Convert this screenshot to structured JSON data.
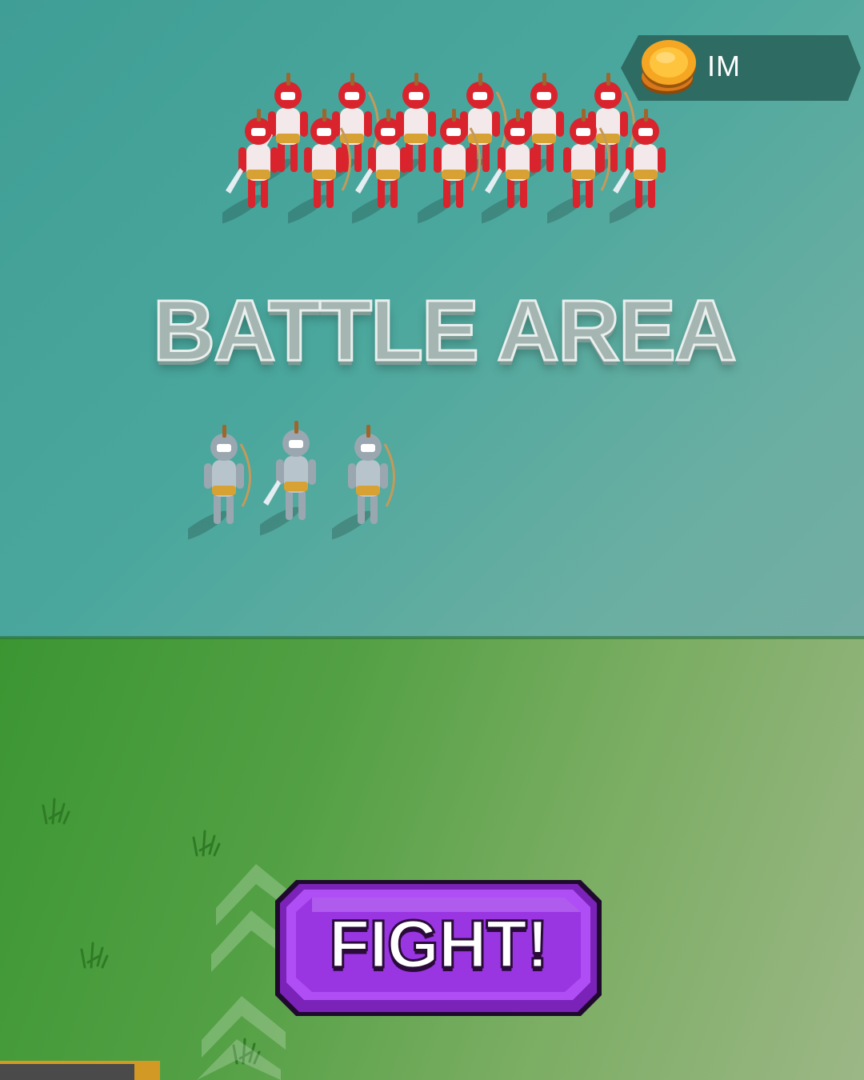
{
  "hud": {
    "coin_value": "IM",
    "coin_icon": "coin-stack-icon"
  },
  "arena": {
    "title": "BATTLE AREA"
  },
  "actions": {
    "fight_label": "FIGHT!"
  },
  "colors": {
    "arena": "#45a399",
    "field": "#53a044",
    "button": "#a23be6",
    "enemy": "#d9242d",
    "ally": "#b8c4cc"
  },
  "units": {
    "enemy_count": 13,
    "ally_count": 3
  }
}
